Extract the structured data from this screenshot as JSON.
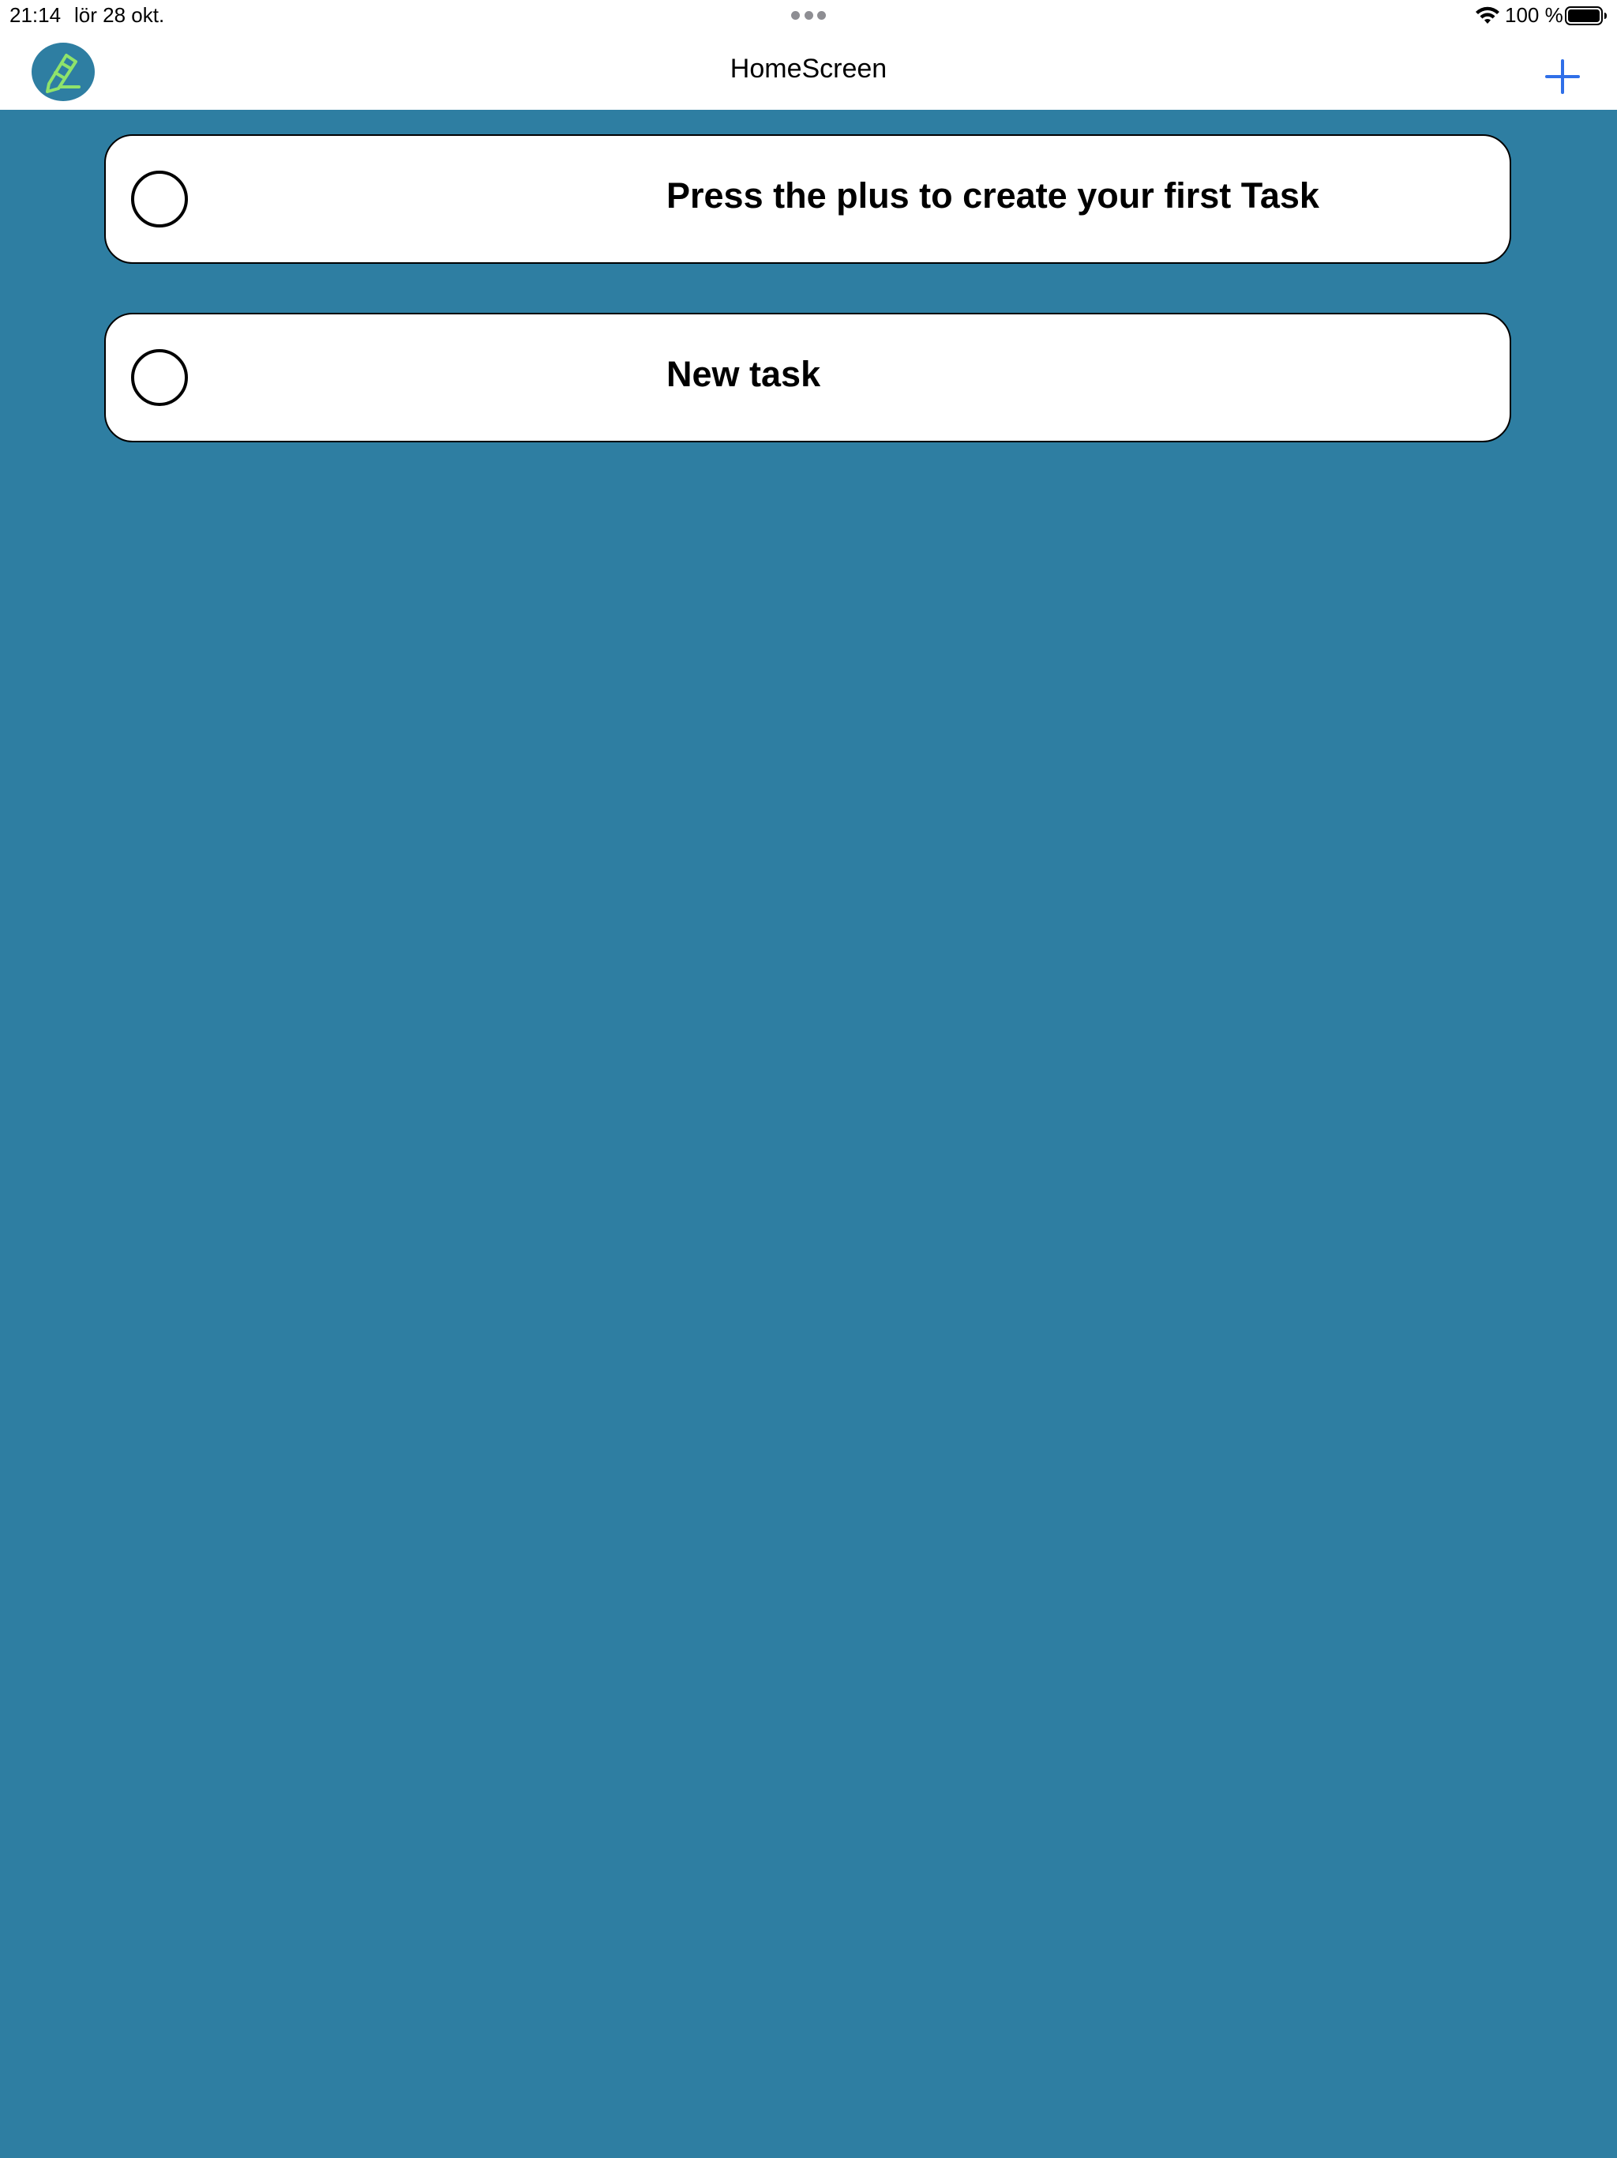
{
  "status_bar": {
    "time": "21:14",
    "date": "lör 28 okt.",
    "battery_percent": "100 %",
    "icons": [
      "wifi-icon",
      "battery-icon"
    ]
  },
  "nav": {
    "title": "HomeScreen",
    "logo_icon": "pencil-logo-icon",
    "add_icon": "plus-icon"
  },
  "tasks": [
    {
      "title": "Press the plus to create your first Task",
      "completed": false
    },
    {
      "title": "New task",
      "completed": false
    }
  ],
  "colors": {
    "background": "#2e7ea2",
    "accent": "#2f6fe8",
    "logo_green": "#8fe36b"
  }
}
